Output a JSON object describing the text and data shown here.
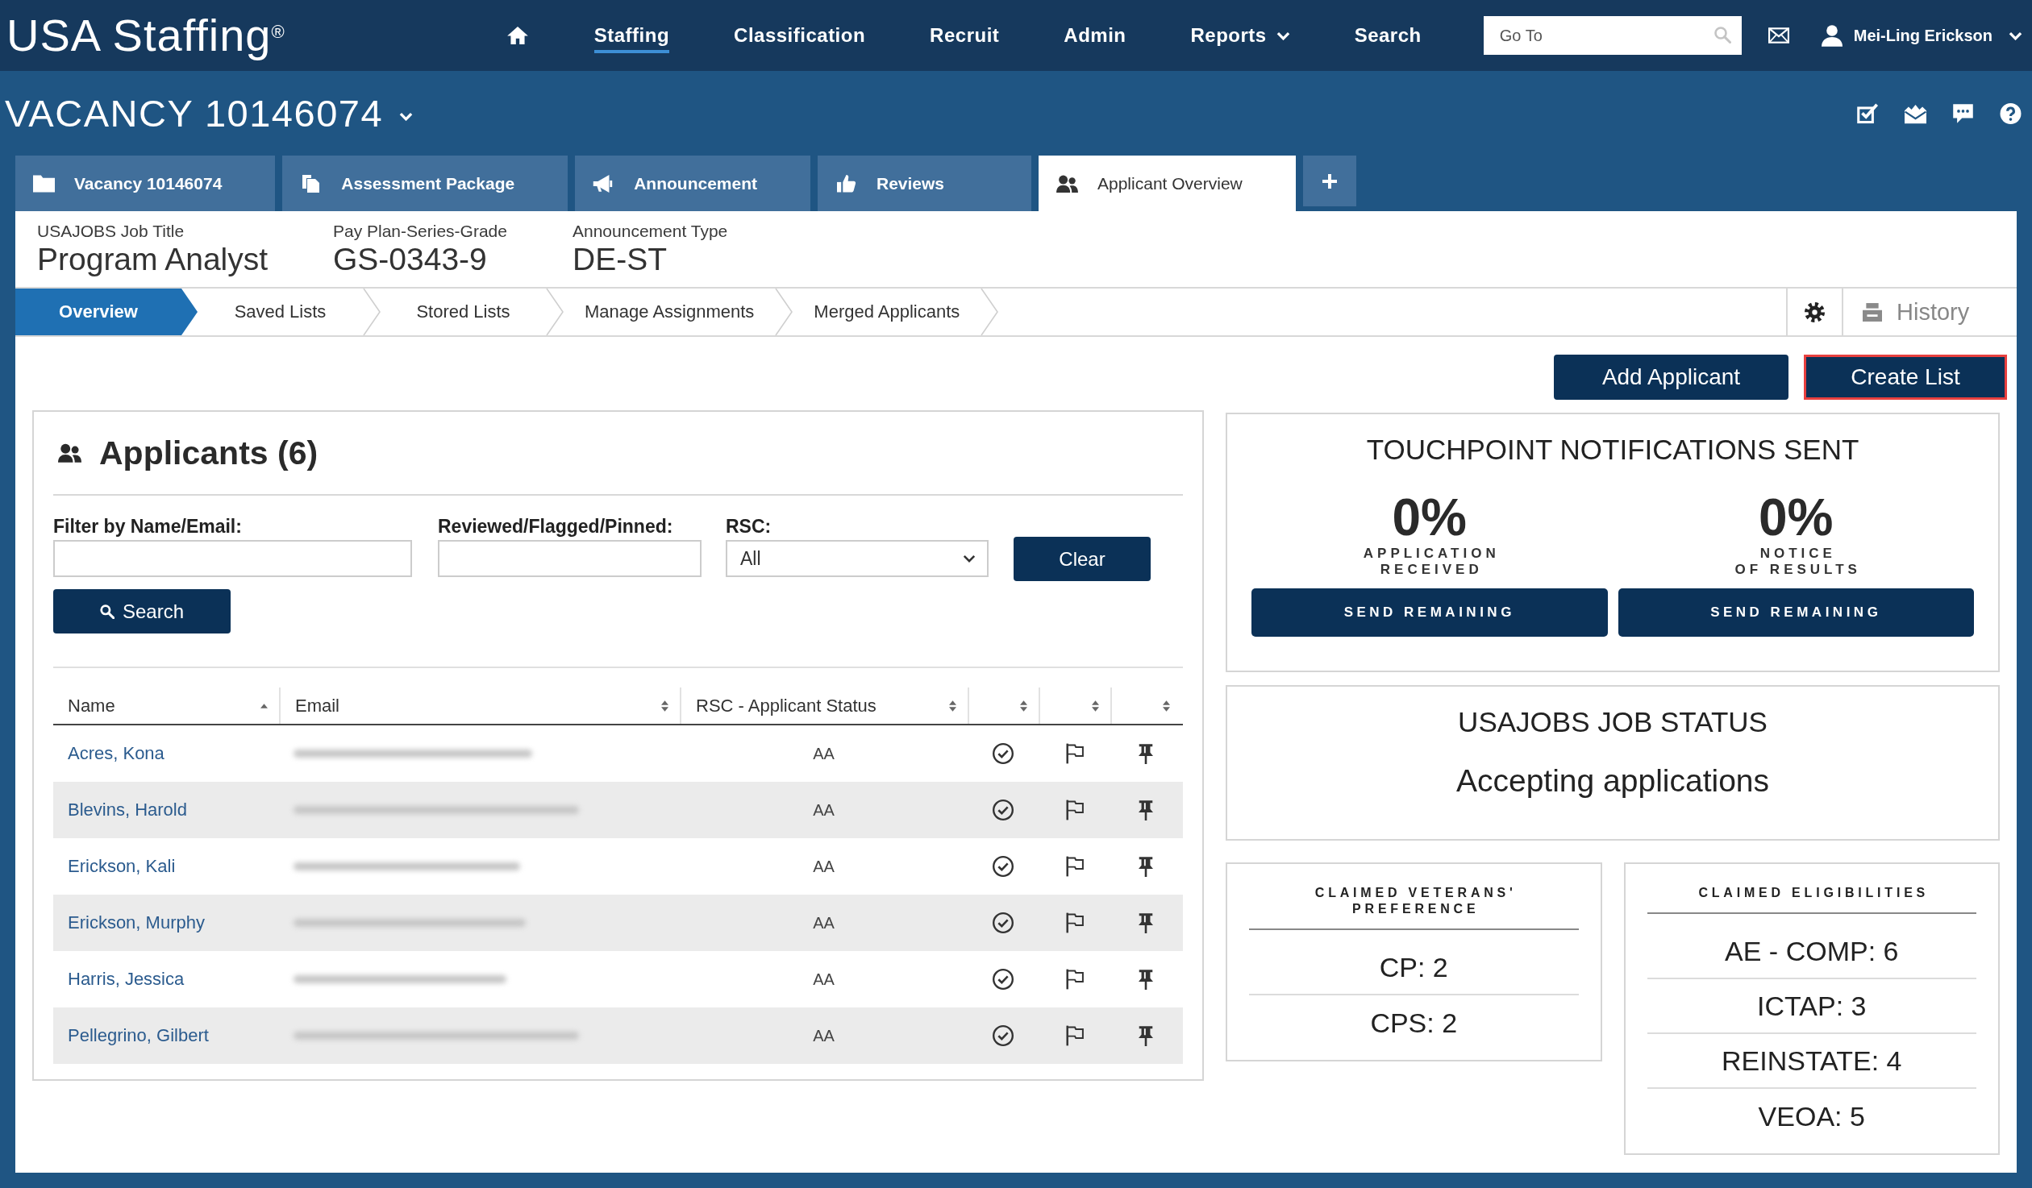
{
  "header": {
    "logo": "USA Staffing$^{®}$",
    "nav": [
      {
        "label": "Staffing",
        "selected": true,
        "dropdown": false
      },
      {
        "label": "Classification",
        "selected": false,
        "dropdown": false
      },
      {
        "label": "Recruit",
        "selected": false,
        "dropdown": false
      },
      {
        "label": "Admin",
        "selected": false,
        "dropdown": false
      },
      {
        "label": "Reports",
        "selected": false,
        "dropdown": true
      },
      {
        "label": "Search",
        "selected": false,
        "dropdown": false
      }
    ],
    "go_to": {
      "placeholder": "Go To"
    },
    "user": "Mei-Ling Erickson"
  },
  "vacancy": {
    "title": "VACANCY 10146074"
  },
  "tabs": [
    {
      "label": "Vacancy 10146074",
      "selected": false
    },
    {
      "label": "Assessment Package",
      "selected": false
    },
    {
      "label": "Announcement",
      "selected": false
    },
    {
      "label": "Reviews",
      "selected": false
    },
    {
      "label": "Applicant Overview",
      "selected": true
    }
  ],
  "job_info": [
    {
      "label": "USAJOBS Job Title",
      "value": "Program Analyst"
    },
    {
      "label": "Pay Plan-Series-Grade",
      "value": "GS-0343-9"
    },
    {
      "label": "Announcement Type",
      "value": "DE-ST"
    }
  ],
  "subnav": {
    "items": [
      {
        "label": "Overview",
        "selected": true
      },
      {
        "label": "Saved Lists",
        "selected": false
      },
      {
        "label": "Stored Lists",
        "selected": false
      },
      {
        "label": "Manage Assignments",
        "selected": false
      },
      {
        "label": "Merged Applicants",
        "selected": false
      }
    ],
    "history": "History"
  },
  "actions": [
    {
      "label": "Add Applicant",
      "highlighted": false
    },
    {
      "label": "Create List",
      "highlighted": true
    }
  ],
  "applicants": {
    "title": "Applicants (6)",
    "filters": [
      {
        "label": "Filter by Name/Email:",
        "kind": "text"
      },
      {
        "label": "Reviewed/Flagged/Pinned:",
        "kind": "text"
      },
      {
        "label": "RSC:",
        "kind": "select",
        "value": "All"
      }
    ],
    "clear_button": "Clear",
    "search_button": "Search",
    "table": {
      "columns": [
        {
          "label": "Name",
          "sorted": true
        },
        {
          "label": "Email",
          "sorted": false
        },
        {
          "label": "RSC - Applicant Status",
          "sorted": false
        },
        {
          "sorted": false
        },
        {
          "sorted": false
        },
        {
          "sorted": false
        }
      ],
      "rows": [
        {
          "name": "Acres, Kona",
          "status": "AA"
        },
        {
          "name": "Blevins, Harold",
          "status": "AA"
        },
        {
          "name": "Erickson, Kali",
          "status": "AA"
        },
        {
          "name": "Erickson, Murphy",
          "status": "AA"
        },
        {
          "name": "Harris, Jessica",
          "status": "AA"
        },
        {
          "name": "Pellegrino, Gilbert",
          "status": "AA"
        }
      ]
    }
  },
  "touchpoint": {
    "title": "TOUCHPOINT NOTIFICATIONS SENT",
    "stats": [
      {
        "value": "0%",
        "label": "APPLICATION\nRECEIVED",
        "button": "SEND REMAINING"
      },
      {
        "value": "0%",
        "label": "NOTICE\nOF RESULTS",
        "button": "SEND REMAINING"
      }
    ]
  },
  "job_status": {
    "title": "USAJOBS JOB STATUS",
    "status": "Accepting applications"
  },
  "veterans_preference": {
    "title": "CLAIMED VETERANS'\nPREFERENCE",
    "items": [
      "CP: 2",
      "CPS: 2"
    ]
  },
  "eligibilities": {
    "title": "CLAIMED ELIGIBILITIES",
    "items": [
      "AE - COMP: 6",
      "ICTAP: 3",
      "REINSTATE: 4",
      "VEOA: 5"
    ]
  }
}
